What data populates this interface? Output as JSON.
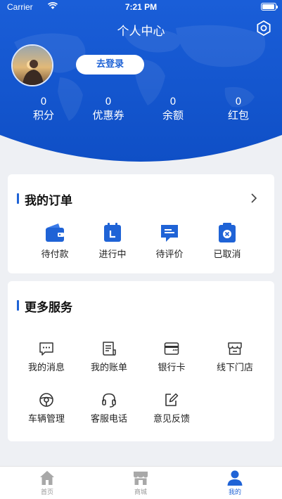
{
  "status_bar": {
    "carrier": "Carrier",
    "time": "7:21 PM"
  },
  "header": {
    "title": "个人中心",
    "login_label": "去登录",
    "stats": [
      {
        "value": "0",
        "label": "积分"
      },
      {
        "value": "0",
        "label": "优惠券"
      },
      {
        "value": "0",
        "label": "余额"
      },
      {
        "value": "0",
        "label": "红包"
      }
    ]
  },
  "orders": {
    "title": "我的订单",
    "items": [
      {
        "label": "待付款",
        "icon": "wallet-icon"
      },
      {
        "label": "进行中",
        "icon": "calendar-icon"
      },
      {
        "label": "待评价",
        "icon": "comment-icon"
      },
      {
        "label": "已取消",
        "icon": "cancel-icon"
      }
    ]
  },
  "services": {
    "title": "更多服务",
    "items": [
      {
        "label": "我的消息",
        "icon": "message-icon"
      },
      {
        "label": "我的账单",
        "icon": "bill-icon"
      },
      {
        "label": "银行卡",
        "icon": "bank-card-icon"
      },
      {
        "label": "线下门店",
        "icon": "store-icon"
      },
      {
        "label": "车辆管理",
        "icon": "steering-wheel-icon"
      },
      {
        "label": "客服电话",
        "icon": "headset-icon"
      },
      {
        "label": "意见反馈",
        "icon": "feedback-icon"
      }
    ]
  },
  "tabbar": {
    "tabs": [
      {
        "label": "首页",
        "icon": "home-icon"
      },
      {
        "label": "商城",
        "icon": "shop-icon"
      },
      {
        "label": "我的",
        "icon": "user-icon"
      }
    ],
    "active": "我的"
  },
  "colors": {
    "primary": "#1f63d6",
    "header_dark": "#1650c4",
    "background": "#eef0f4"
  }
}
